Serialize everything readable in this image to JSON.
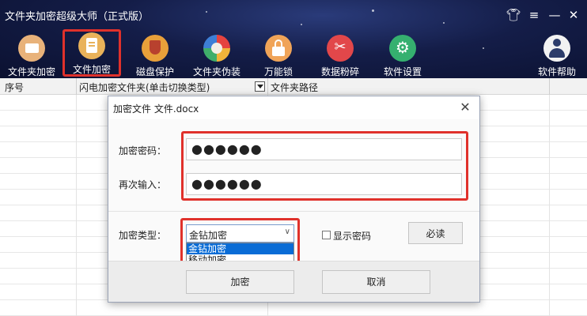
{
  "window": {
    "title": "文件夹加密超级大师（正式版）"
  },
  "toolbar": {
    "items": [
      {
        "label": "文件夹加密",
        "icon": "folder-icon",
        "color": "#e8b27a"
      },
      {
        "label": "文件加密",
        "icon": "file-lock-icon",
        "color": "#e9b25a",
        "active": true
      },
      {
        "label": "磁盘保护",
        "icon": "shield-icon",
        "color": "#e8a03a"
      },
      {
        "label": "文件夹伪装",
        "icon": "palette-icon",
        "color": "#e6e3d8"
      },
      {
        "label": "万能锁",
        "icon": "padlock-icon",
        "color": "#f0a458"
      },
      {
        "label": "数据粉碎",
        "icon": "scissors-icon",
        "color": "#e2474a"
      },
      {
        "label": "软件设置",
        "icon": "gear-icon",
        "color": "#35b06f"
      },
      {
        "label": "软件帮助",
        "icon": "user-icon",
        "color": "#f2f2f2"
      }
    ]
  },
  "table": {
    "headers": [
      "序号",
      "闪电加密文件夹(单击切换类型)",
      "文件夹路径"
    ]
  },
  "dialog": {
    "title": "加密文件 文件.docx",
    "password_label": "加密密码：",
    "password_value": "●●●●●●",
    "confirm_label": "再次输入：",
    "confirm_value": "●●●●●●",
    "type_label": "加密类型：",
    "type_selected": "金钻加密",
    "type_options": [
      "金钻加密",
      "移动加密"
    ],
    "show_password_label": "显示密码",
    "must_read_label": "必读",
    "encrypt_button": "加密",
    "cancel_button": "取消"
  },
  "colors": {
    "highlight": "#e0312b",
    "selection": "#0a6cd6",
    "banner": "#141d48"
  }
}
